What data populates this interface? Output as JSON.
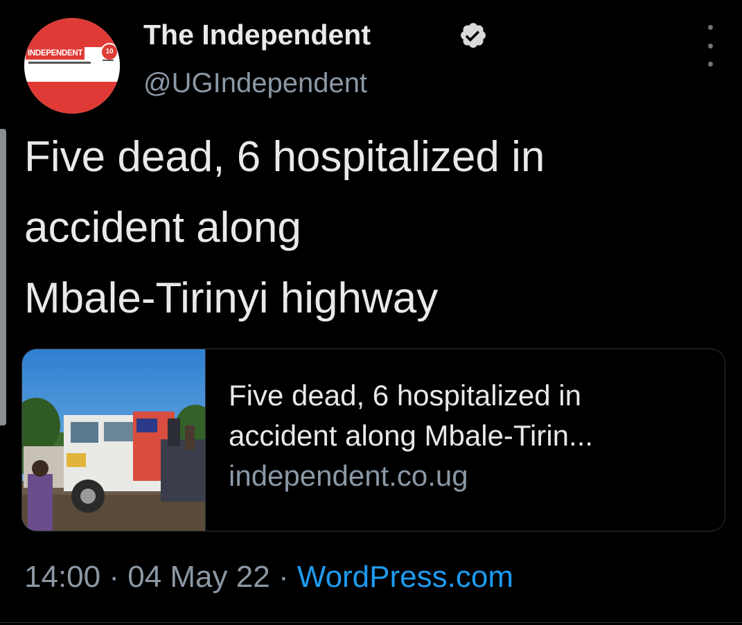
{
  "tweet": {
    "author": {
      "name": "The Independent",
      "handle": "@UGIndependent",
      "avatar_text": "INDEPENDENT",
      "avatar_badge": "10",
      "verified": true,
      "icon": "verified-badge-icon"
    },
    "text_lines": [
      "Five dead, 6 hospitalized in",
      "accident along",
      "Mbale-Tirinyi highway"
    ],
    "card": {
      "title_lines": [
        "Five dead, 6 hospitalized in",
        "accident along Mbale-Tirin..."
      ],
      "domain": "independent.co.ug",
      "image_alt": "accident-scene-photo"
    },
    "meta": {
      "time": "14:00",
      "separator": "·",
      "date": "04 May 22",
      "source": "WordPress.com"
    }
  },
  "colors": {
    "background": "#000000",
    "text_primary": "#e7e9ea",
    "text_secondary": "#8b98a5",
    "link": "#1d9bf0",
    "border": "#2f3336",
    "avatar_red": "#e03a36"
  }
}
